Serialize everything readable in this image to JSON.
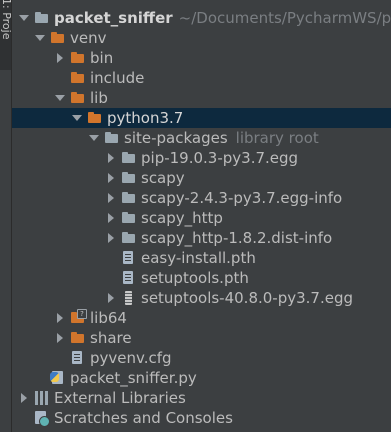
{
  "side_panel": {
    "tab_label": "1: Proje"
  },
  "tree": {
    "root": {
      "name": "packet_sniffer",
      "path": "~/Documents/PycharmWS/p"
    },
    "venv": "venv",
    "bin": "bin",
    "include": "include",
    "lib": "lib",
    "python": "python3.7",
    "site_packages": {
      "name": "site-packages",
      "hint": "library root"
    },
    "packages": [
      "pip-19.0.3-py3.7.egg",
      "scapy",
      "scapy-2.4.3-py3.7.egg-info",
      "scapy_http",
      "scapy_http-1.8.2.dist-info"
    ],
    "pth_files": [
      "easy-install.pth",
      "setuptools.pth"
    ],
    "setuptools_egg": "setuptools-40.8.0-py3.7.egg",
    "lib64": "lib64",
    "share": "share",
    "pyvenv": "pyvenv.cfg",
    "main_file": "packet_sniffer.py",
    "external_libraries": "External Libraries",
    "scratches": "Scratches and Consoles"
  }
}
